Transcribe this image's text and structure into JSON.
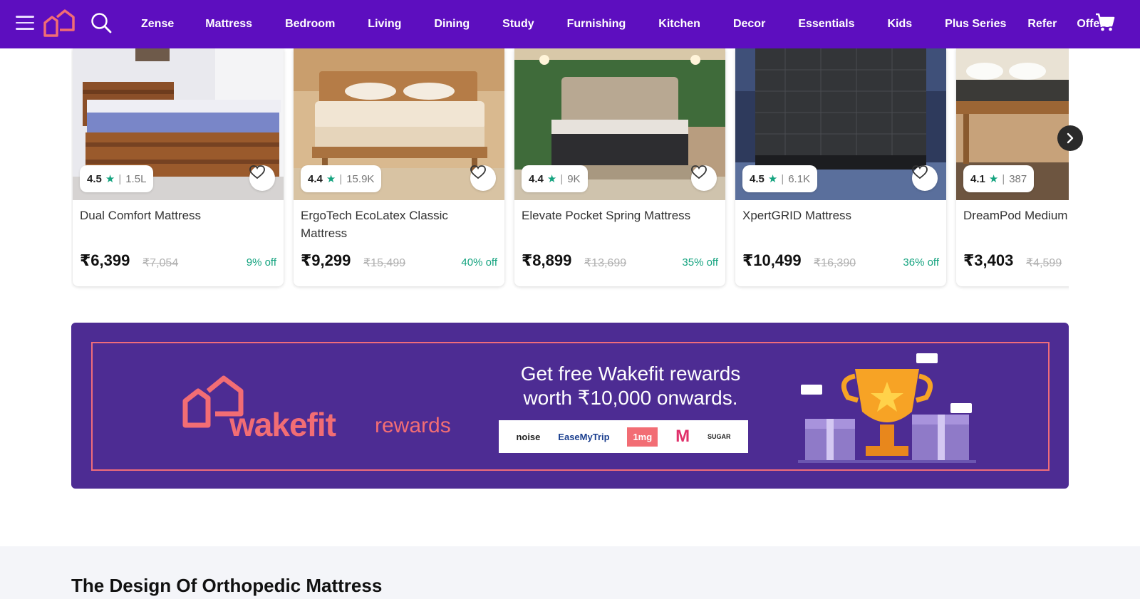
{
  "nav": {
    "links": [
      "Zense",
      "Mattress",
      "Bedroom",
      "Living",
      "Dining",
      "Study",
      "Furnishing",
      "Kitchen",
      "Decor",
      "Essentials",
      "Kids",
      "Plus Series",
      "Refer",
      "Offers"
    ],
    "icons": {
      "menu": "hamburger-menu-icon",
      "logo": "wakefit-logo-icon",
      "search": "search-icon",
      "cart": "cart-icon"
    },
    "background": "#5d0ebf"
  },
  "products": [
    {
      "rating": "4.5",
      "reviews": "1.5L",
      "name": "Dual Comfort Mattress",
      "price": "₹6,399",
      "mrp": "₹7,054",
      "discount": "9% off"
    },
    {
      "rating": "4.4",
      "reviews": "15.9K",
      "name": "ErgoTech EcoLatex Classic Mattress",
      "price": "₹9,299",
      "mrp": "₹15,499",
      "discount": "40% off"
    },
    {
      "rating": "4.4",
      "reviews": "9K",
      "name": "Elevate Pocket Spring Mattress",
      "price": "₹8,899",
      "mrp": "₹13,699",
      "discount": "35% off"
    },
    {
      "rating": "4.5",
      "reviews": "6.1K",
      "name": "XpertGRID Mattress",
      "price": "₹10,499",
      "mrp": "₹16,390",
      "discount": "36% off"
    },
    {
      "rating": "4.1",
      "reviews": "387",
      "name": "DreamPod Medium Mattress",
      "price": "₹3,403",
      "mrp": "₹4,599",
      "discount": ""
    }
  ],
  "banner": {
    "brand": "wakefit",
    "brand_sub": "rewards",
    "headline": "Get free Wakefit rewards worth ₹10,000 onwards.",
    "partners": [
      "noise",
      "EaseMyTrip",
      "1mg",
      "M",
      "SUGAR"
    ],
    "colors": {
      "background": "#4d2c93",
      "accent": "#f26d74"
    }
  },
  "section": {
    "title": "The Design Of Orthopedic Mattress"
  },
  "colors": {
    "discount": "#14a37f",
    "star": "#14a37f"
  }
}
